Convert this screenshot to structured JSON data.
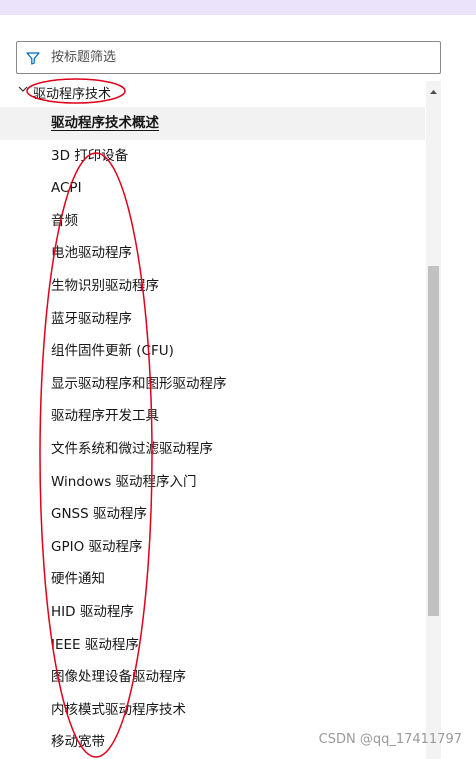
{
  "filter": {
    "placeholder": "按标题筛选",
    "icon": "filter-icon"
  },
  "tree": {
    "section_label": "驱动程序技术",
    "items": [
      "驱动程序技术概述",
      "3D 打印设备",
      "ACPI",
      "音频",
      "电池驱动程序",
      "生物识别驱动程序",
      "蓝牙驱动程序",
      "组件固件更新 (CFU)",
      "显示驱动程序和图形驱动程序",
      "驱动程序开发工具",
      "文件系统和微过滤驱动程序",
      "Windows 驱动程序入门",
      "GNSS 驱动程序",
      "GPIO 驱动程序",
      "硬件通知",
      "HID 驱动程序",
      "IEEE 驱动程序",
      "图像处理设备驱动程序",
      "内核模式驱动程序技术",
      "移动宽带"
    ],
    "active_index": 0
  },
  "annotation_color": "#e0001a",
  "watermark": "CSDN @qq_17411797"
}
